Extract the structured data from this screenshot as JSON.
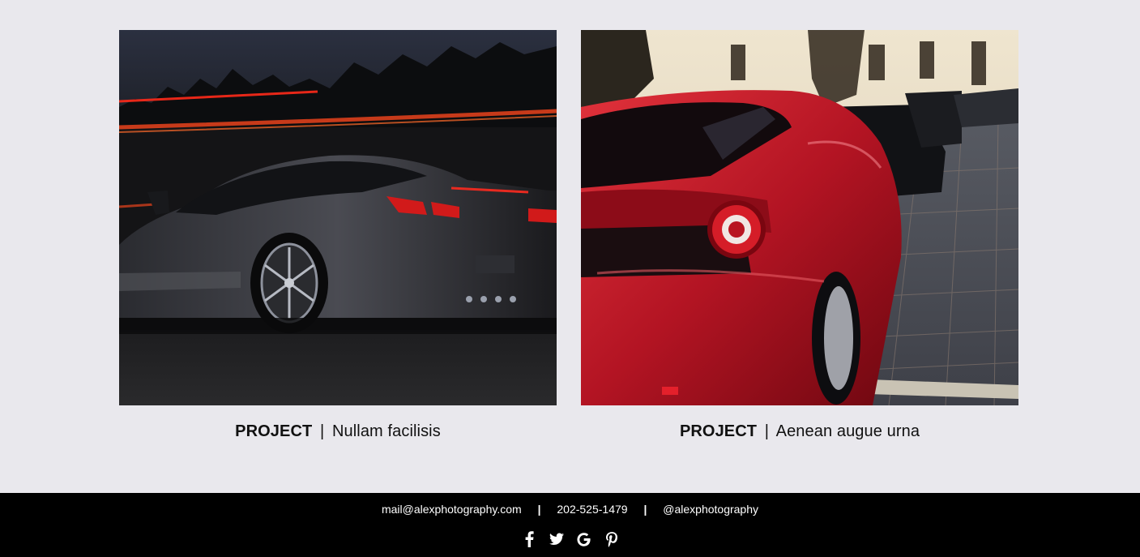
{
  "projects": [
    {
      "label": "PROJECT",
      "separator": "|",
      "title": "Nullam facilisis",
      "image_alt": "dark sports car at dusk with red light trails"
    },
    {
      "label": "PROJECT",
      "separator": "|",
      "title": " Aenean augue urna",
      "image_alt": "red sports car parked on a city street"
    }
  ],
  "footer": {
    "email": "mail@alexphotography.com",
    "phone": "202-525-1479",
    "handle": "@alexphotography",
    "divider": "|",
    "social_icons": [
      "facebook-icon",
      "twitter-icon",
      "google-icon",
      "pinterest-icon"
    ]
  },
  "colors": {
    "page_background": "#e9e8ed",
    "footer_background": "#000000",
    "footer_text": "#ffffff",
    "caption_text": "#111111"
  }
}
